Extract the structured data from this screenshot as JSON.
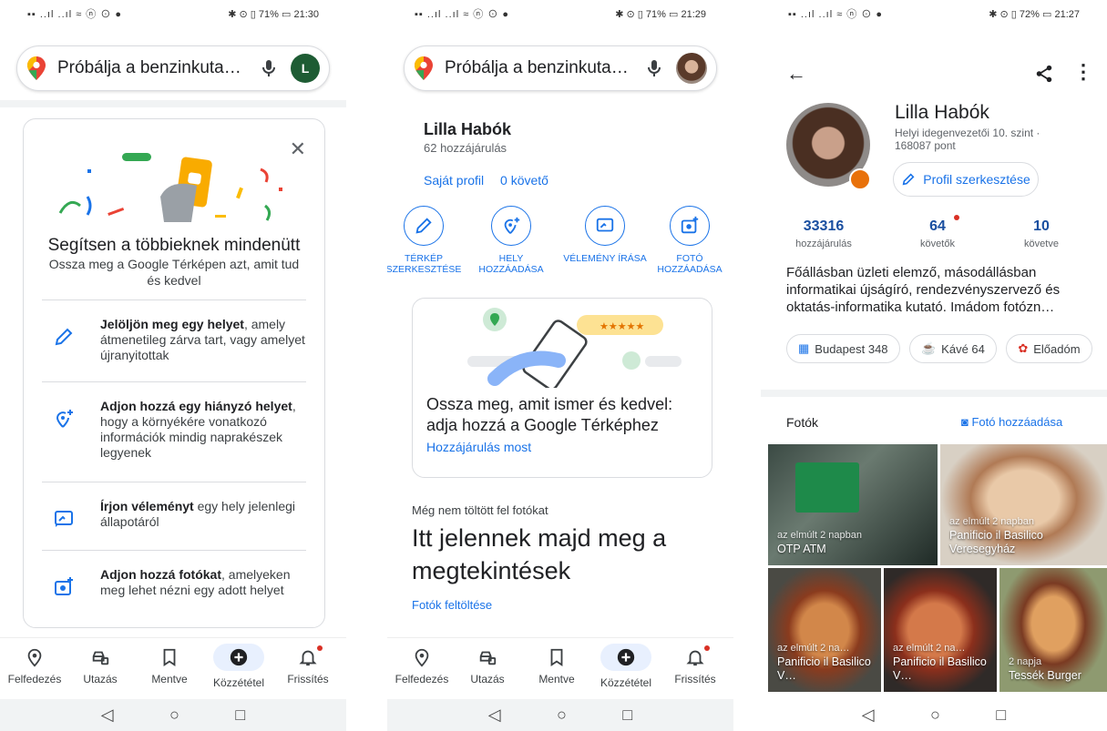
{
  "status": {
    "phone1_time": "21:30",
    "phone2_time": "21:29",
    "phone3_time": "21:27",
    "battery1": "71%",
    "battery2": "71%",
    "battery3": "72%"
  },
  "search": {
    "placeholder": "Próbálja a benzinkuta…",
    "avatar_letter": "L"
  },
  "phone1": {
    "card_title": "Segítsen a többieknek mindenütt",
    "card_subtitle": "Ossza meg a Google Térképen azt, amit tud és kedvel",
    "items": [
      {
        "bold": "Jelöljön meg egy helyet",
        "rest": ", amely átmenetileg zárva tart, vagy amelyet újranyitottak"
      },
      {
        "bold": "Adjon hozzá egy hiányzó helyet",
        "rest": ", hogy a környékére vonatkozó információk mindig naprakészek legyenek"
      },
      {
        "bold": "Írjon véleményt",
        "rest": " egy hely jelenlegi állapotáról"
      },
      {
        "bold": "Adjon hozzá fotókat",
        "rest": ", amelyeken meg lehet nézni egy adott helyet"
      }
    ]
  },
  "nav": {
    "explore": "Felfedezés",
    "travel": "Utazás",
    "saved": "Mentve",
    "contribute": "Közzététel",
    "updates": "Frissítés"
  },
  "phone2": {
    "name": "Lilla Habók",
    "contributions": "62 hozzájárulás",
    "own_profile": "Saját profil",
    "followers": "0 követő",
    "actions": [
      "TÉRKÉP SZERKESZTÉSE",
      "HELY HOZZÁADÁSA",
      "VÉLEMÉNY ÍRÁSA",
      "FOTÓ HOZZÁADÁSA"
    ],
    "card_text": "Ossza meg, amit ismer és kedvel: adja hozzá a Google Térképhez",
    "card_link": "Hozzájárulás most",
    "no_photos": "Még nem töltött fel fotókat",
    "big_text": "Itt jelennek majd meg a megtekintések",
    "upload_link": "Fotók feltöltése"
  },
  "phone3": {
    "name": "Lilla Habók",
    "level": "Helyi idegenvezetői 10. szint · 168087 pont",
    "edit_profile": "Profil szerkesztése",
    "stats": [
      {
        "value": "33316",
        "label": "hozzájárulás"
      },
      {
        "value": "64",
        "label": "követők"
      },
      {
        "value": "10",
        "label": "követve"
      }
    ],
    "bio": "Főállásban üzleti elemző, másodállásban informatikai újságíró, rendezvényszervező és oktatás-informatika kutató. Imádom fotózn…",
    "chips": [
      "Budapest 348",
      "Kávé 64",
      "Előadóm"
    ],
    "photos_title": "Fotók",
    "add_photo": "Fotó hozzáadása",
    "photos": [
      {
        "when": "az elmúlt 2 napban",
        "place": "OTP ATM"
      },
      {
        "when": "az elmúlt 2 napban",
        "place": "Panificio il Basilico Veresegyház"
      },
      {
        "when": "az elmúlt 2 na…",
        "place": "Panificio il Basilico V…"
      },
      {
        "when": "az elmúlt 2 na…",
        "place": "Panificio il Basilico V…"
      },
      {
        "when": "2 napja",
        "place": "Tessék Burger"
      }
    ]
  },
  "colors": {
    "accent": "#1a73e8",
    "badge": "#e8710a",
    "avatar": "#1e5c34"
  }
}
